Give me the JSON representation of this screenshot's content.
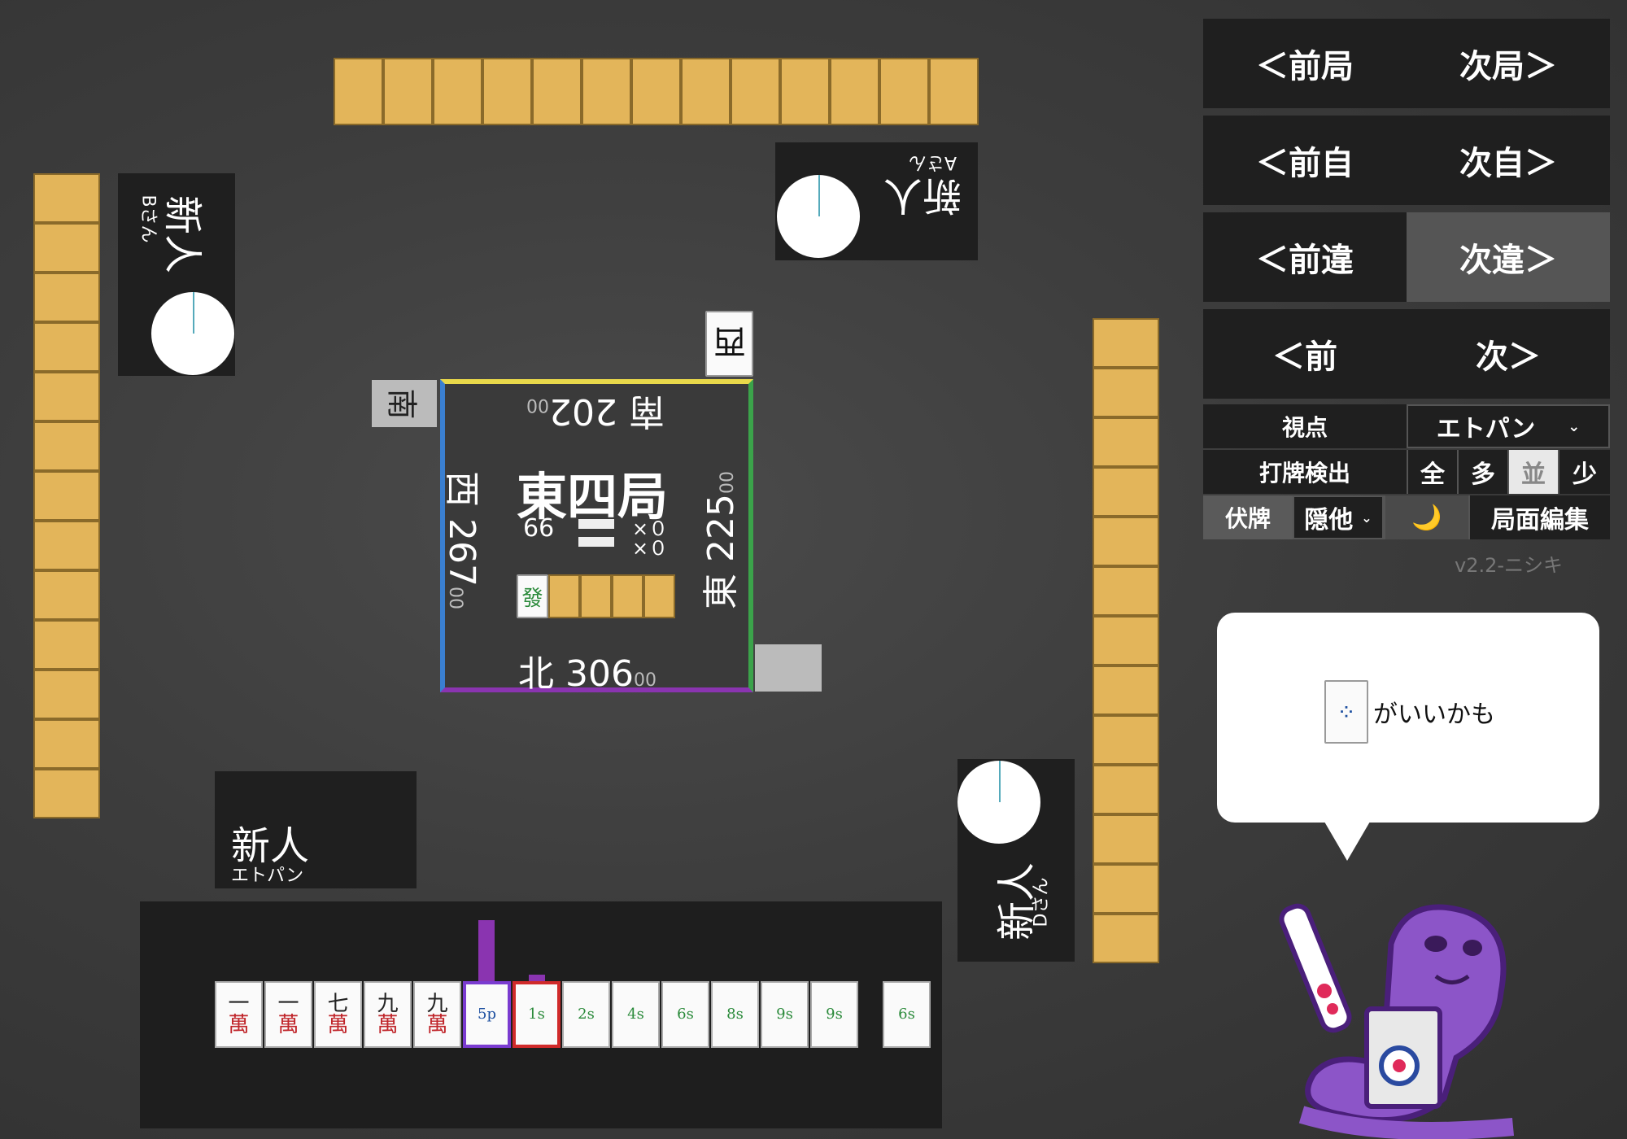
{
  "walls": {
    "top_count": 13,
    "left_count": 13,
    "right_count": 13
  },
  "players": {
    "top": {
      "name": "新人",
      "sub": "Aさん"
    },
    "left": {
      "name": "新人",
      "sub": "Bさん"
    },
    "right": {
      "name": "新人",
      "sub": "Dさん"
    },
    "bottom": {
      "name": "新人",
      "sub": "エトパン"
    }
  },
  "board": {
    "round": "東四局",
    "remaining": "66",
    "honba": "×０",
    "riichi": "×０",
    "scores": {
      "south": {
        "wind": "南",
        "main": "202",
        "small": "00"
      },
      "west": {
        "wind": "西",
        "main": "267",
        "small": "00"
      },
      "east": {
        "wind": "東",
        "main": "225",
        "small": "00"
      },
      "north": {
        "wind": "北",
        "main": "306",
        "small": "00"
      }
    },
    "dora_tile": "發",
    "south_marker": "南",
    "top_marker": "西"
  },
  "nav": {
    "prev_round": "＜前局",
    "next_round": "次局＞",
    "prev_self": "＜前自",
    "next_self": "次自＞",
    "prev_diff": "＜前違",
    "next_diff": "次違＞",
    "prev": "＜前",
    "next": "次＞"
  },
  "controls": {
    "viewpoint_label": "視点",
    "viewpoint_value": "エトパン",
    "detect_label": "打牌検出",
    "detect_options": [
      "全",
      "多",
      "並",
      "少"
    ],
    "detect_selected": "並",
    "hidden_label": "伏牌",
    "hidden_value": "隠他",
    "moon_icon": "🌙",
    "edit_label": "局面編集",
    "version": "v2.2-ニシキ"
  },
  "hand": {
    "tiles": [
      {
        "n": "一",
        "s": "萬"
      },
      {
        "n": "一",
        "s": "萬"
      },
      {
        "n": "七",
        "s": "萬"
      },
      {
        "n": "九",
        "s": "萬"
      },
      {
        "n": "九",
        "s": "萬"
      },
      {
        "n": "5p",
        "s": ""
      },
      {
        "n": "1s",
        "s": ""
      },
      {
        "n": "2s",
        "s": ""
      },
      {
        "n": "4s",
        "s": ""
      },
      {
        "n": "6s",
        "s": ""
      },
      {
        "n": "8s",
        "s": ""
      },
      {
        "n": "9s",
        "s": ""
      },
      {
        "n": "9s",
        "s": ""
      }
    ],
    "drawn": {
      "n": "6s",
      "s": ""
    }
  },
  "advice": {
    "tile": "5p",
    "text": "がいいかも"
  },
  "colors": {
    "accent_gold": "#e3b55a",
    "board_top": "#e8d84a",
    "board_right": "#3ba34a",
    "board_bottom": "#8a34b0",
    "board_left": "#3a7fd0"
  }
}
